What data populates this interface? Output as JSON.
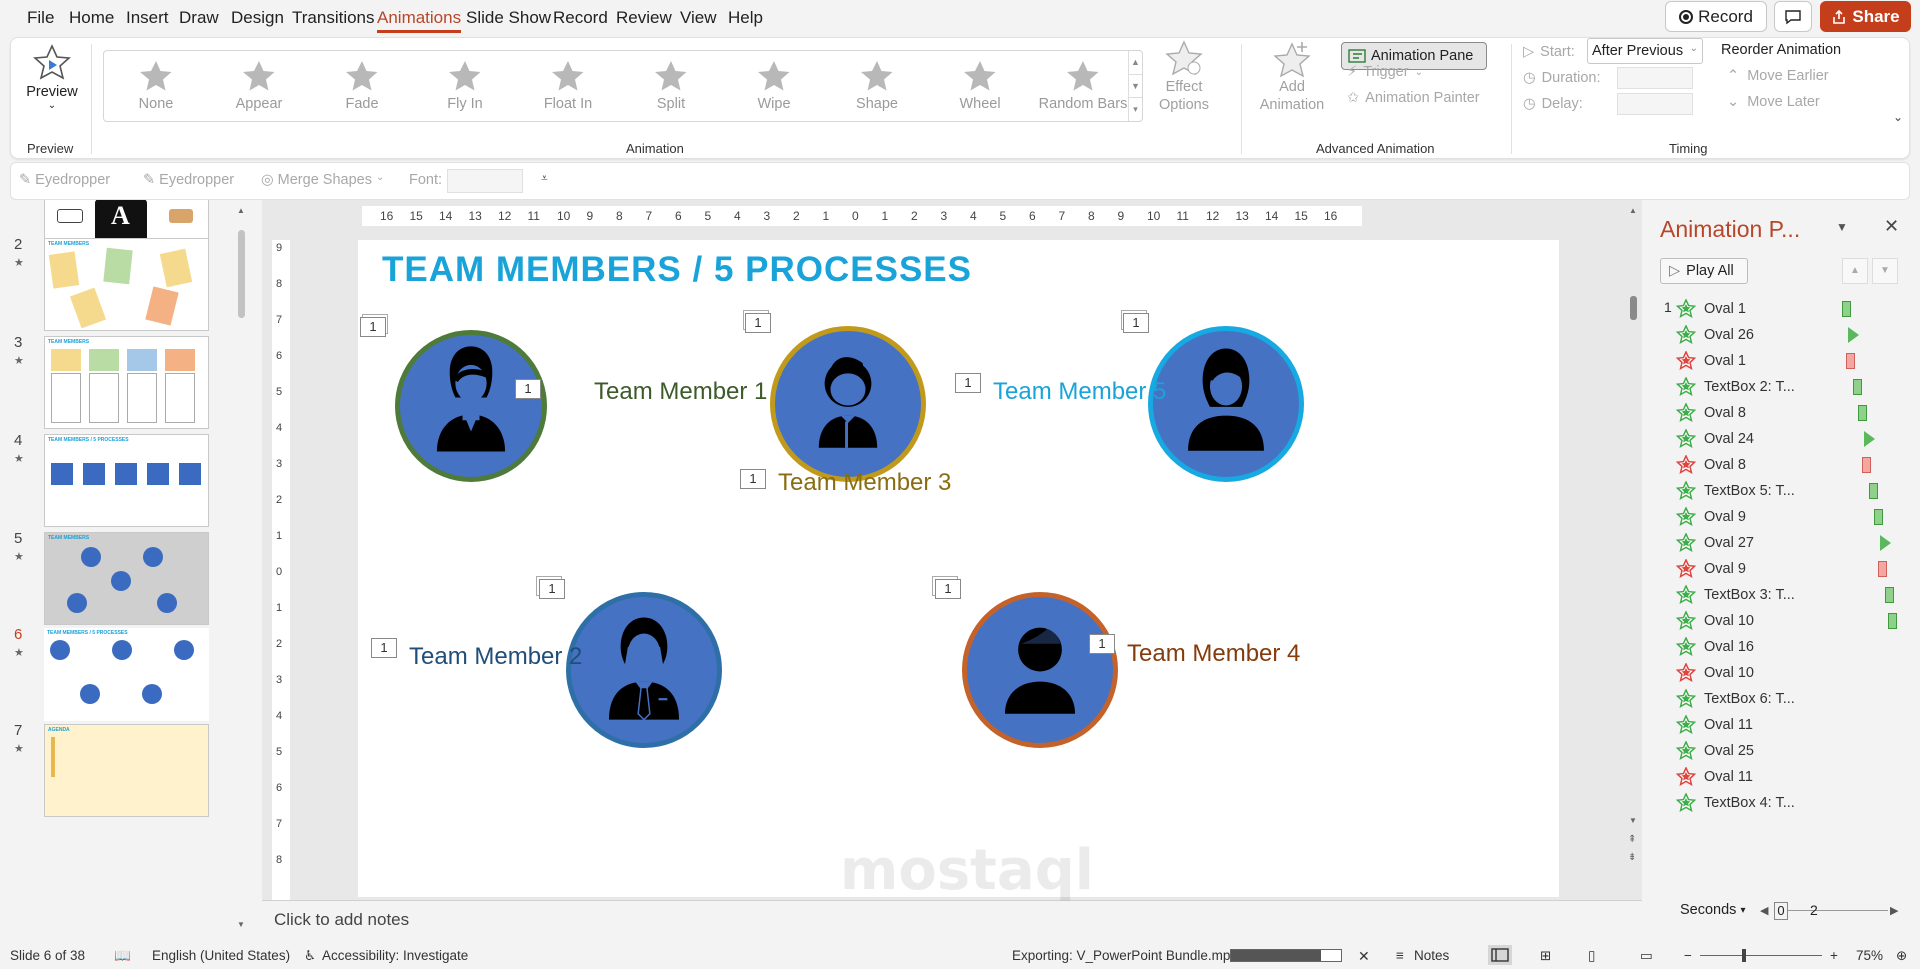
{
  "menu": {
    "items": [
      "File",
      "Home",
      "Insert",
      "Draw",
      "Design",
      "Transitions",
      "Animations",
      "Slide Show",
      "Record",
      "Review",
      "View",
      "Help"
    ],
    "active": "Animations",
    "record_label": "Record",
    "share_label": "Share"
  },
  "ribbon": {
    "preview_label": "Preview",
    "preview_group": "Preview",
    "animations": [
      "None",
      "Appear",
      "Fade",
      "Fly In",
      "Float In",
      "Split",
      "Wipe",
      "Shape",
      "Wheel",
      "Random Bars"
    ],
    "effect_options": "Effect Options",
    "animation_group": "Animation",
    "add_animation": "Add Animation",
    "animation_pane": "Animation Pane",
    "trigger": "Trigger",
    "animation_painter": "Animation Painter",
    "advanced_group": "Advanced Animation",
    "start_label": "Start:",
    "start_value": "After Previous",
    "duration_label": "Duration:",
    "delay_label": "Delay:",
    "timing_group": "Timing",
    "reorder_title": "Reorder Animation",
    "move_earlier": "Move Earlier",
    "move_later": "Move Later"
  },
  "qat": {
    "eyedropper1": "Eyedropper",
    "eyedropper2": "Eyedropper",
    "merge_shapes": "Merge Shapes",
    "font_label": "Font:"
  },
  "thumbnails": [
    {
      "num": "",
      "starred": false
    },
    {
      "num": "2",
      "starred": true,
      "title": "TEAM MEMBERS"
    },
    {
      "num": "3",
      "starred": true,
      "title": "TEAM MEMBERS"
    },
    {
      "num": "4",
      "starred": true,
      "title": "TEAM MEMBERS / 5 PROCESSES"
    },
    {
      "num": "5",
      "starred": true,
      "title": "TEAM MEMBERS"
    },
    {
      "num": "6",
      "starred": true,
      "title": "TEAM MEMBERS / 5 PROCESSES",
      "active": true
    },
    {
      "num": "7",
      "starred": true,
      "title": "AGENDA"
    }
  ],
  "slide": {
    "title": "TEAM MEMBERS / 5 PROCESSES",
    "title_color": "#1aa3d9",
    "members": [
      {
        "label": "Team Member 1",
        "ring": "#4e7a3a",
        "color": "#3d5a2b"
      },
      {
        "label": "Team Member 2",
        "ring": "#2e6fa8",
        "color": "#1f4e79"
      },
      {
        "label": "Team Member 3",
        "ring": "#c19a1b",
        "color": "#8a6d12"
      },
      {
        "label": "Team Member 4",
        "ring": "#c5622a",
        "color": "#843c0c"
      },
      {
        "label": "Team Member 5",
        "ring": "#17a9e1",
        "color": "#1aa3d9"
      }
    ],
    "tag": "1"
  },
  "rulers": {
    "horizontal": [
      "16",
      "15",
      "14",
      "13",
      "12",
      "11",
      "10",
      "9",
      "8",
      "7",
      "6",
      "5",
      "4",
      "3",
      "2",
      "1",
      "0",
      "1",
      "2",
      "3",
      "4",
      "5",
      "6",
      "7",
      "8",
      "9",
      "10",
      "11",
      "12",
      "13",
      "14",
      "15",
      "16"
    ],
    "vertical": [
      "9",
      "8",
      "7",
      "6",
      "5",
      "4",
      "3",
      "2",
      "1",
      "0",
      "1",
      "2",
      "3",
      "4",
      "5",
      "6",
      "7",
      "8"
    ]
  },
  "notes_placeholder": "Click to add notes",
  "animation_pane": {
    "title": "Animation P...",
    "play_all": "Play All",
    "first_index": "1",
    "items": [
      {
        "name": "Oval 1",
        "type": "entrance",
        "offset": 0.42
      },
      {
        "name": "Oval 26",
        "type": "emphasis",
        "offset": 0.48
      },
      {
        "name": "Oval 1",
        "type": "exit",
        "offset": 0.48
      },
      {
        "name": "TextBox 2: T...",
        "type": "entrance",
        "offset": 0.56
      },
      {
        "name": "Oval 8",
        "type": "entrance",
        "offset": 0.62
      },
      {
        "name": "Oval 24",
        "type": "emphasis",
        "offset": 0.68
      },
      {
        "name": "Oval 8",
        "type": "exit",
        "offset": 0.68
      },
      {
        "name": "TextBox 5: T...",
        "type": "entrance",
        "offset": 0.76
      },
      {
        "name": "Oval 9",
        "type": "entrance",
        "offset": 0.82
      },
      {
        "name": "Oval 27",
        "type": "emphasis",
        "offset": 0.88
      },
      {
        "name": "Oval 9",
        "type": "exit",
        "offset": 0.88
      },
      {
        "name": "TextBox 3: T...",
        "type": "entrance",
        "offset": 0.96
      },
      {
        "name": "Oval 10",
        "type": "entrance",
        "offset": 1.0
      },
      {
        "name": "Oval 16",
        "type": "emphasis",
        "offset": null
      },
      {
        "name": "Oval 10",
        "type": "exit",
        "offset": null
      },
      {
        "name": "TextBox 6: T...",
        "type": "entrance",
        "offset": null
      },
      {
        "name": "Oval 11",
        "type": "entrance",
        "offset": null
      },
      {
        "name": "Oval 25",
        "type": "emphasis",
        "offset": null
      },
      {
        "name": "Oval 11",
        "type": "exit",
        "offset": null
      },
      {
        "name": "TextBox 4: T...",
        "type": "entrance",
        "offset": null
      }
    ],
    "seconds_label": "Seconds",
    "timeline_start": "0",
    "timeline_mid": "2"
  },
  "status": {
    "slide_info": "Slide 6 of 38",
    "language": "English (United States)",
    "accessibility": "Accessibility: Investigate",
    "exporting": "Exporting: V_PowerPoint Bundle.mp4",
    "export_progress": 0.82,
    "notes": "Notes",
    "zoom": "75%"
  },
  "colors": {
    "accent": "#c43e1c",
    "entrance": "#5cb85c",
    "emphasis": "#3fb64c",
    "exit": "#e0443c",
    "circle_fill": "#4672c4"
  }
}
